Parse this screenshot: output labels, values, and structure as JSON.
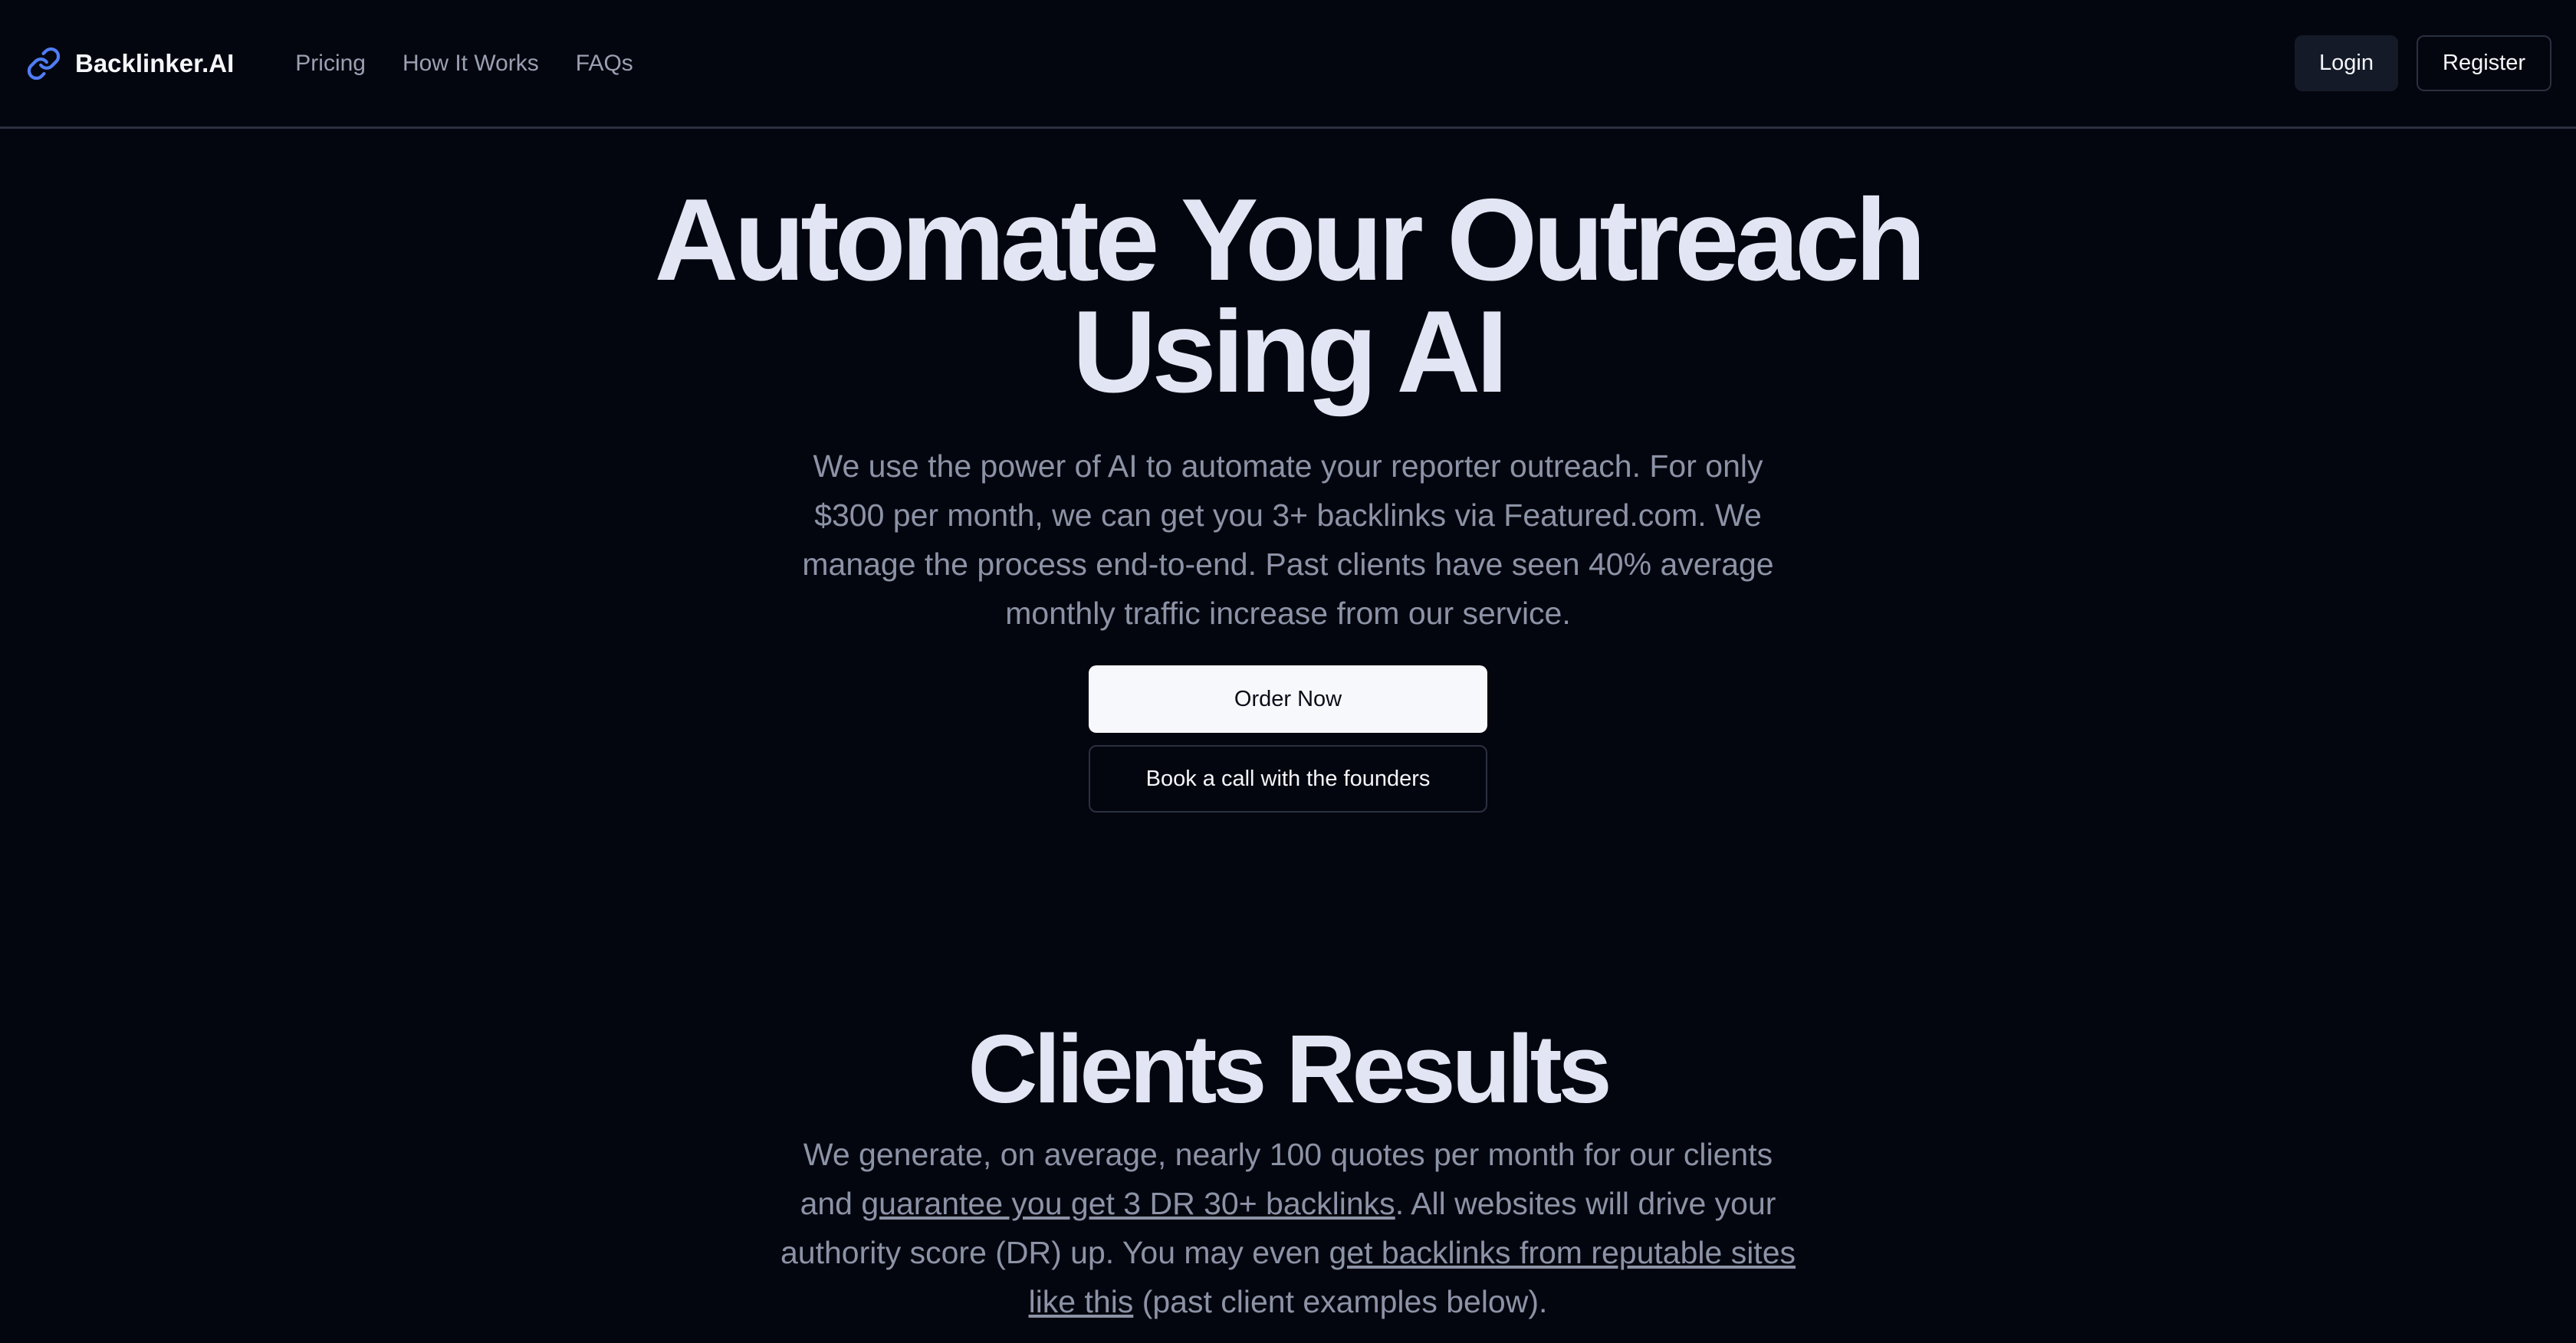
{
  "nav": {
    "brand": "Backlinker.AI",
    "brand_icon": "link-icon",
    "links": [
      "Pricing",
      "How It Works",
      "FAQs"
    ],
    "login_label": "Login",
    "register_label": "Register"
  },
  "hero": {
    "title_line1": "Automate Your Outreach",
    "title_line2": "Using AI",
    "subtitle": "We use the power of AI to automate your reporter outreach. For only $300 per month, we can get you 3+ backlinks via Featured.com. We manage the process end-to-end. Past clients have seen 40% average monthly traffic increase from our service.",
    "order_label": "Order Now",
    "call_label": "Book a call with the founders"
  },
  "results": {
    "title": "Clients Results",
    "text_part1": "We generate, on average, nearly 100 quotes per month for our clients and ",
    "link1": "guarantee you get 3 DR 30+ backlinks",
    "text_part2": ". All websites will drive your authority score (DR) up. You may even ",
    "link2": "get backlinks from reputable sites like this",
    "text_part3": " (past client examples below)."
  },
  "colors": {
    "background": "#04060f",
    "accent_icon": "#4f7df3",
    "text_muted": "#8d93a6",
    "heading": "#e2e5f3"
  }
}
